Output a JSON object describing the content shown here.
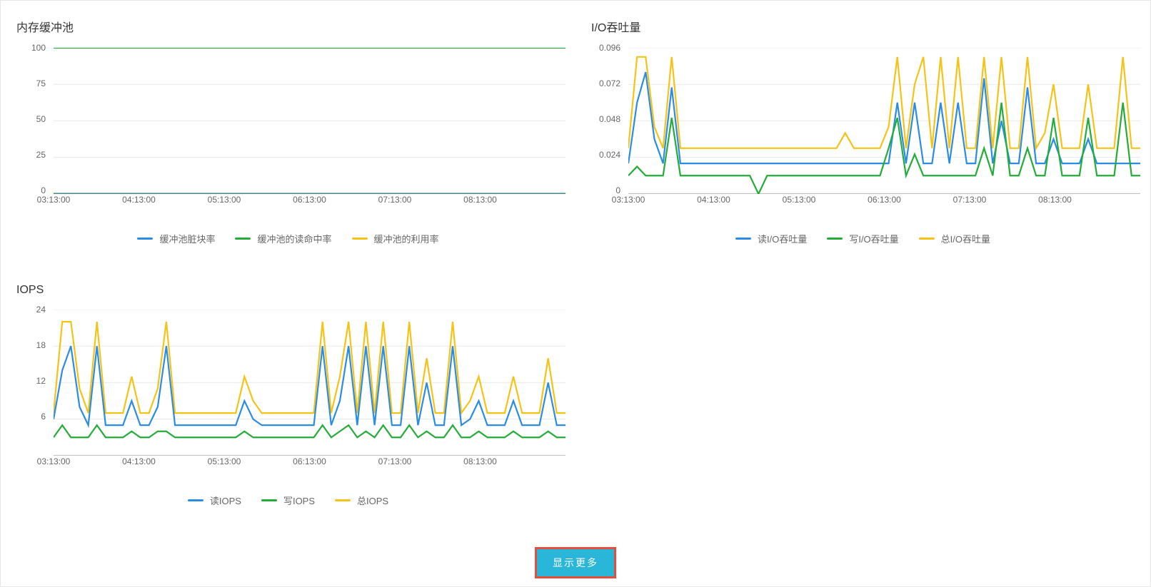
{
  "colors": {
    "blue": "#2B8CE6",
    "green": "#23AC38",
    "yellow": "#F5C316"
  },
  "footer": {
    "more_label": "显示更多"
  },
  "x_categories": [
    "03:13:00",
    "04:13:00",
    "05:13:00",
    "06:13:00",
    "07:13:00",
    "08:13:00"
  ],
  "panels": [
    {
      "id": "mem",
      "title": "内存缓冲池",
      "ymin": 0,
      "ymax": 100,
      "yticks": [
        0,
        25,
        50,
        75,
        100
      ],
      "legend": [
        {
          "key": "a",
          "label": "缓冲池脏块率",
          "color": "blue"
        },
        {
          "key": "b",
          "label": "缓冲池的读命中率",
          "color": "green"
        },
        {
          "key": "c",
          "label": "缓冲池的利用率",
          "color": "yellow"
        }
      ]
    },
    {
      "id": "io",
      "title": "I/O吞吐量",
      "ymin": 0,
      "ymax": 0.096,
      "yticks": [
        0,
        0.024,
        0.048,
        0.072,
        0.096
      ],
      "legend": [
        {
          "key": "a",
          "label": "读I/O吞吐量",
          "color": "blue"
        },
        {
          "key": "b",
          "label": "写I/O吞吐量",
          "color": "green"
        },
        {
          "key": "c",
          "label": "总I/O吞吐量",
          "color": "yellow"
        }
      ]
    },
    {
      "id": "iops",
      "title": "IOPS",
      "ymin": 0,
      "ymax": 24,
      "yticks": [
        6,
        12,
        18,
        24
      ],
      "legend": [
        {
          "key": "a",
          "label": "读IOPS",
          "color": "blue"
        },
        {
          "key": "b",
          "label": "写IOPS",
          "color": "green"
        },
        {
          "key": "c",
          "label": "总IOPS",
          "color": "yellow"
        }
      ]
    }
  ],
  "chart_data": [
    {
      "id": "mem",
      "type": "line",
      "title": "内存缓冲池",
      "xlabel": "",
      "ylabel": "",
      "ylim": [
        0,
        100
      ],
      "x": [
        0,
        1,
        2,
        3,
        4,
        5,
        6,
        7,
        8,
        9,
        10,
        11,
        12,
        13,
        14,
        15,
        16,
        17,
        18,
        19,
        20,
        21,
        22,
        23,
        24,
        25,
        26,
        27,
        28,
        29,
        30,
        31,
        32,
        33,
        34,
        35,
        36,
        37,
        38,
        39,
        40,
        41,
        42,
        43,
        44,
        45,
        46,
        47,
        48,
        49,
        50,
        51,
        52,
        53,
        54,
        55,
        56,
        57,
        58,
        59
      ],
      "series": [
        {
          "name": "缓冲池脏块率",
          "color": "blue",
          "values": [
            0,
            0,
            0,
            0,
            0,
            0,
            0,
            0,
            0,
            0,
            0,
            0,
            0,
            0,
            0,
            0,
            0,
            0,
            0,
            0,
            0,
            0,
            0,
            0,
            0,
            0,
            0,
            0,
            0,
            0,
            0,
            0,
            0,
            0,
            0,
            0,
            0,
            0,
            0,
            0,
            0,
            0,
            0,
            0,
            0,
            0,
            0,
            0,
            0,
            0,
            0,
            0,
            0,
            0,
            0,
            0,
            0,
            0,
            0,
            0
          ]
        },
        {
          "name": "缓冲池的读命中率",
          "color": "green",
          "values": [
            100,
            100,
            100,
            100,
            100,
            100,
            100,
            100,
            100,
            100,
            100,
            100,
            100,
            100,
            100,
            100,
            100,
            100,
            100,
            100,
            100,
            100,
            100,
            100,
            100,
            100,
            100,
            100,
            100,
            100,
            100,
            100,
            100,
            100,
            100,
            100,
            100,
            100,
            100,
            100,
            100,
            100,
            100,
            100,
            100,
            100,
            100,
            100,
            100,
            100,
            100,
            100,
            100,
            100,
            100,
            100,
            100,
            100,
            100,
            100
          ]
        },
        {
          "name": "缓冲池的利用率",
          "color": "yellow",
          "values": [
            0.3,
            0.3,
            0.3,
            0.3,
            0.3,
            0.3,
            0.3,
            0.3,
            0.3,
            0.3,
            0.3,
            0.3,
            0.3,
            0.3,
            0.3,
            0.3,
            0.3,
            0.3,
            0.3,
            0.3,
            0.3,
            0.3,
            0.3,
            0.3,
            0.3,
            0.3,
            0.3,
            0.3,
            0.3,
            0.3,
            0.3,
            0.3,
            0.3,
            0.3,
            0.3,
            0.3,
            0.3,
            0.3,
            0.3,
            0.3,
            0.3,
            0.3,
            0.3,
            0.3,
            0.3,
            0.3,
            0.3,
            0.3,
            0.3,
            0.3,
            0.3,
            0.3,
            0.3,
            0.3,
            0.3,
            0.3,
            0.3,
            0.3,
            0.3,
            0.3
          ]
        }
      ],
      "x_tick_labels": [
        "03:13:00",
        "04:13:00",
        "05:13:00",
        "06:13:00",
        "07:13:00",
        "08:13:00"
      ]
    },
    {
      "id": "io",
      "type": "line",
      "title": "I/O吞吐量",
      "xlabel": "",
      "ylabel": "",
      "ylim": [
        0,
        0.096
      ],
      "x": [
        0,
        1,
        2,
        3,
        4,
        5,
        6,
        7,
        8,
        9,
        10,
        11,
        12,
        13,
        14,
        15,
        16,
        17,
        18,
        19,
        20,
        21,
        22,
        23,
        24,
        25,
        26,
        27,
        28,
        29,
        30,
        31,
        32,
        33,
        34,
        35,
        36,
        37,
        38,
        39,
        40,
        41,
        42,
        43,
        44,
        45,
        46,
        47,
        48,
        49,
        50,
        51,
        52,
        53,
        54,
        55,
        56,
        57,
        58,
        59
      ],
      "series": [
        {
          "name": "读I/O吞吐量",
          "color": "blue",
          "values": [
            0.02,
            0.06,
            0.08,
            0.036,
            0.02,
            0.07,
            0.02,
            0.02,
            0.02,
            0.02,
            0.02,
            0.02,
            0.02,
            0.02,
            0.02,
            0.02,
            0.02,
            0.02,
            0.02,
            0.02,
            0.02,
            0.02,
            0.02,
            0.02,
            0.02,
            0.02,
            0.02,
            0.02,
            0.02,
            0.02,
            0.02,
            0.06,
            0.02,
            0.06,
            0.02,
            0.02,
            0.06,
            0.02,
            0.06,
            0.02,
            0.02,
            0.076,
            0.02,
            0.048,
            0.02,
            0.02,
            0.07,
            0.02,
            0.02,
            0.036,
            0.02,
            0.02,
            0.02,
            0.036,
            0.02,
            0.02,
            0.02,
            0.02,
            0.02,
            0.02
          ]
        },
        {
          "name": "写I/O吞吐量",
          "color": "green",
          "values": [
            0.012,
            0.018,
            0.012,
            0.012,
            0.012,
            0.05,
            0.012,
            0.012,
            0.012,
            0.012,
            0.012,
            0.012,
            0.012,
            0.012,
            0.012,
            0.0,
            0.012,
            0.012,
            0.012,
            0.012,
            0.012,
            0.012,
            0.012,
            0.012,
            0.012,
            0.012,
            0.012,
            0.012,
            0.012,
            0.012,
            0.03,
            0.05,
            0.012,
            0.026,
            0.012,
            0.012,
            0.012,
            0.012,
            0.012,
            0.012,
            0.012,
            0.03,
            0.012,
            0.06,
            0.012,
            0.012,
            0.03,
            0.012,
            0.012,
            0.05,
            0.012,
            0.012,
            0.012,
            0.05,
            0.012,
            0.012,
            0.012,
            0.06,
            0.012,
            0.012
          ]
        },
        {
          "name": "总I/O吞吐量",
          "color": "yellow",
          "values": [
            0.03,
            0.09,
            0.09,
            0.044,
            0.03,
            0.09,
            0.03,
            0.03,
            0.03,
            0.03,
            0.03,
            0.03,
            0.03,
            0.03,
            0.03,
            0.03,
            0.03,
            0.03,
            0.03,
            0.03,
            0.03,
            0.03,
            0.03,
            0.03,
            0.03,
            0.04,
            0.03,
            0.03,
            0.03,
            0.03,
            0.044,
            0.09,
            0.03,
            0.072,
            0.09,
            0.03,
            0.09,
            0.03,
            0.09,
            0.03,
            0.03,
            0.09,
            0.03,
            0.09,
            0.03,
            0.03,
            0.09,
            0.03,
            0.04,
            0.072,
            0.03,
            0.03,
            0.03,
            0.072,
            0.03,
            0.03,
            0.03,
            0.09,
            0.03,
            0.03
          ]
        }
      ],
      "x_tick_labels": [
        "03:13:00",
        "04:13:00",
        "05:13:00",
        "06:13:00",
        "07:13:00",
        "08:13:00"
      ]
    },
    {
      "id": "iops",
      "type": "line",
      "title": "IOPS",
      "xlabel": "",
      "ylabel": "",
      "ylim": [
        0,
        24
      ],
      "x": [
        0,
        1,
        2,
        3,
        4,
        5,
        6,
        7,
        8,
        9,
        10,
        11,
        12,
        13,
        14,
        15,
        16,
        17,
        18,
        19,
        20,
        21,
        22,
        23,
        24,
        25,
        26,
        27,
        28,
        29,
        30,
        31,
        32,
        33,
        34,
        35,
        36,
        37,
        38,
        39,
        40,
        41,
        42,
        43,
        44,
        45,
        46,
        47,
        48,
        49,
        50,
        51,
        52,
        53,
        54,
        55,
        56,
        57,
        58,
        59
      ],
      "series": [
        {
          "name": "读IOPS",
          "color": "blue",
          "values": [
            6,
            14,
            18,
            8,
            5,
            18,
            5,
            5,
            5,
            9,
            5,
            5,
            8,
            18,
            5,
            5,
            5,
            5,
            5,
            5,
            5,
            5,
            9,
            6,
            5,
            5,
            5,
            5,
            5,
            5,
            5,
            18,
            5,
            9,
            18,
            5,
            18,
            5,
            18,
            5,
            5,
            18,
            5,
            12,
            5,
            5,
            18,
            5,
            6,
            9,
            5,
            5,
            5,
            9,
            5,
            5,
            5,
            12,
            5,
            5
          ]
        },
        {
          "name": "写IOPS",
          "color": "green",
          "values": [
            3,
            5,
            3,
            3,
            3,
            5,
            3,
            3,
            3,
            4,
            3,
            3,
            4,
            4,
            3,
            3,
            3,
            3,
            3,
            3,
            3,
            3,
            4,
            3,
            3,
            3,
            3,
            3,
            3,
            3,
            3,
            5,
            3,
            4,
            5,
            3,
            4,
            3,
            5,
            3,
            3,
            5,
            3,
            4,
            3,
            3,
            5,
            3,
            3,
            4,
            3,
            3,
            3,
            4,
            3,
            3,
            3,
            4,
            3,
            3
          ]
        },
        {
          "name": "总IOPS",
          "color": "yellow",
          "values": [
            7,
            22,
            22,
            11,
            7,
            22,
            7,
            7,
            7,
            13,
            7,
            7,
            11,
            22,
            7,
            7,
            7,
            7,
            7,
            7,
            7,
            7,
            13,
            9,
            7,
            7,
            7,
            7,
            7,
            7,
            7,
            22,
            7,
            13,
            22,
            7,
            22,
            7,
            22,
            7,
            7,
            22,
            7,
            16,
            7,
            7,
            22,
            7,
            9,
            13,
            7,
            7,
            7,
            13,
            7,
            7,
            7,
            16,
            7,
            7
          ]
        }
      ],
      "x_tick_labels": [
        "03:13:00",
        "04:13:00",
        "05:13:00",
        "06:13:00",
        "07:13:00",
        "08:13:00"
      ]
    }
  ]
}
